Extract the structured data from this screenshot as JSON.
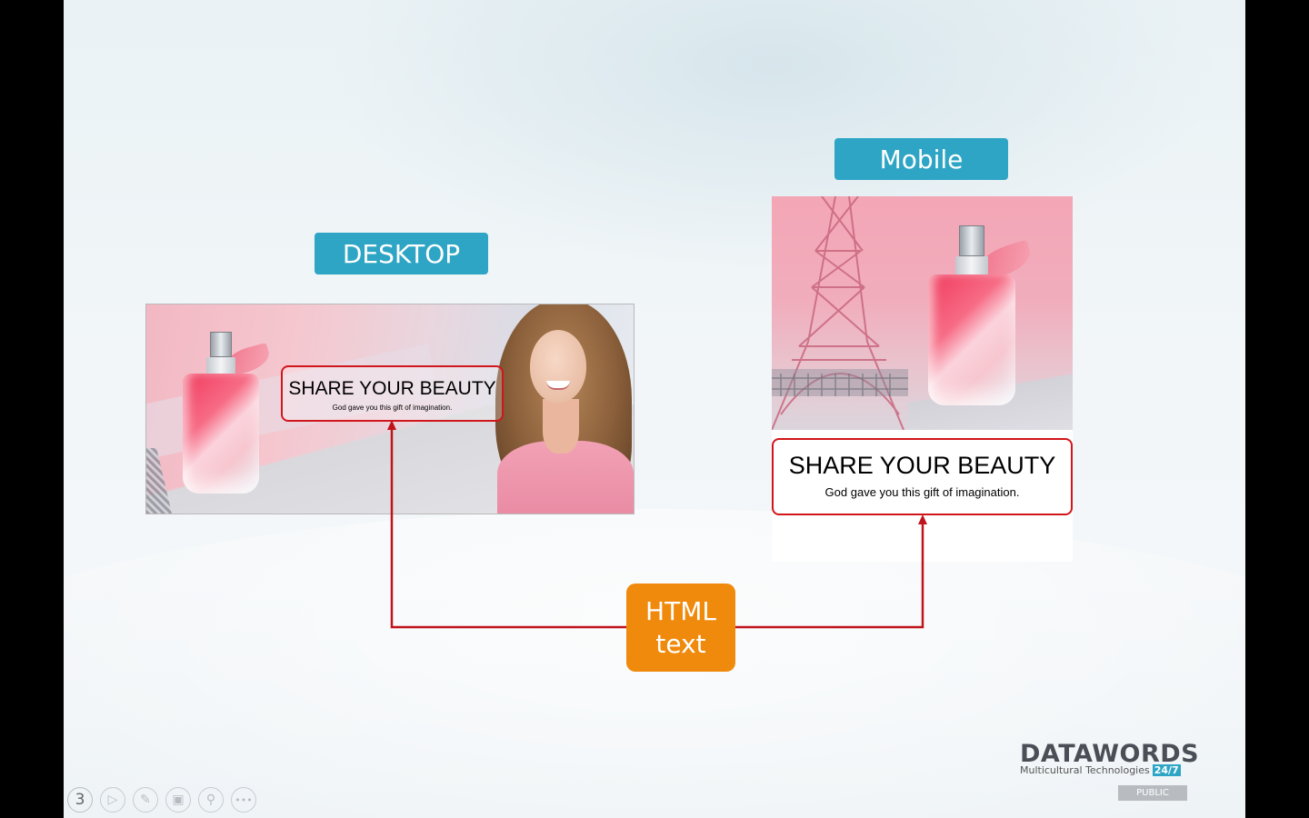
{
  "labels": {
    "desktop": "DESKTOP",
    "mobile": "Mobile"
  },
  "desktop_banner": {
    "headline": "SHARE YOUR BEAUTY",
    "subline": "God gave you this  gift of imagination."
  },
  "mobile_banner": {
    "headline": "SHARE YOUR BEAUTY",
    "subline": "God gave you this  gift of imagination."
  },
  "callout": {
    "line1": "HTML",
    "line2": "text"
  },
  "logo": {
    "word": "DATAWORDS",
    "tagline": "Multicultural Technologies",
    "badge": "24/7"
  },
  "classification": "PUBLIC",
  "slide_controls": {
    "slide_number": "3"
  },
  "colors": {
    "label_bg": "#2ea5c5",
    "callout_bg": "#f08a0c",
    "outline": "#d1161b"
  }
}
